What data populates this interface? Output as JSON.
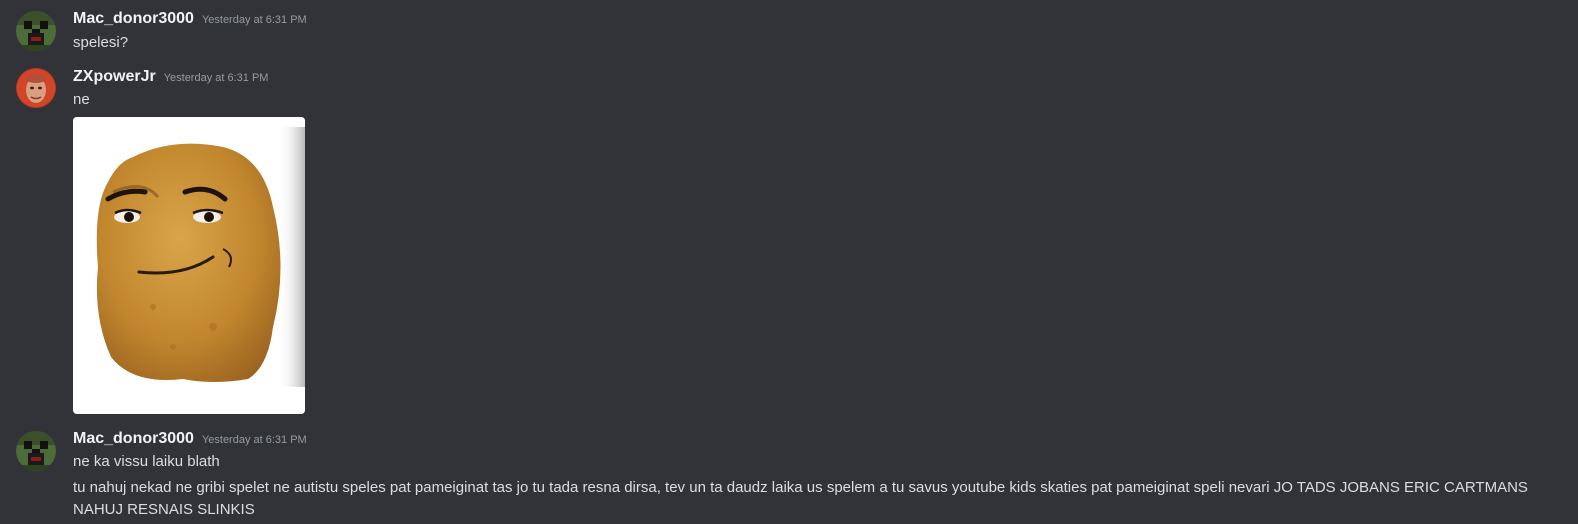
{
  "messages": [
    {
      "username": "Mac_donor3000",
      "timestamp": "Yesterday at 6:31 PM",
      "lines": [
        "spelesi?"
      ],
      "avatar_icon": "pixel-creeper-avatar-icon"
    },
    {
      "username": "ZXpowerJr",
      "timestamp": "Yesterday at 6:31 PM",
      "lines": [
        "ne"
      ],
      "avatar_icon": "face-photo-avatar-icon",
      "attachment": "chicken-nugget-face-image"
    },
    {
      "username": "Mac_donor3000",
      "timestamp": "Yesterday at 6:31 PM",
      "lines": [
        "ne ka vissu laiku blath",
        "tu nahuj nekad ne gribi spelet ne autistu speles pat pameiginat tas jo tu tada resna dirsa, tev un ta daudz laika us spelem a tu savus youtube kids skaties pat pameiginat speli nevari JO TADS JOBANS ERIC CARTMANS NAHUJ RESNAIS SLINKIS"
      ],
      "avatar_icon": "pixel-creeper-avatar-icon"
    }
  ],
  "colors": {
    "background": "#313338",
    "username": "#f2f3f5",
    "timestamp": "#949ba4",
    "text": "#dbdee1"
  }
}
